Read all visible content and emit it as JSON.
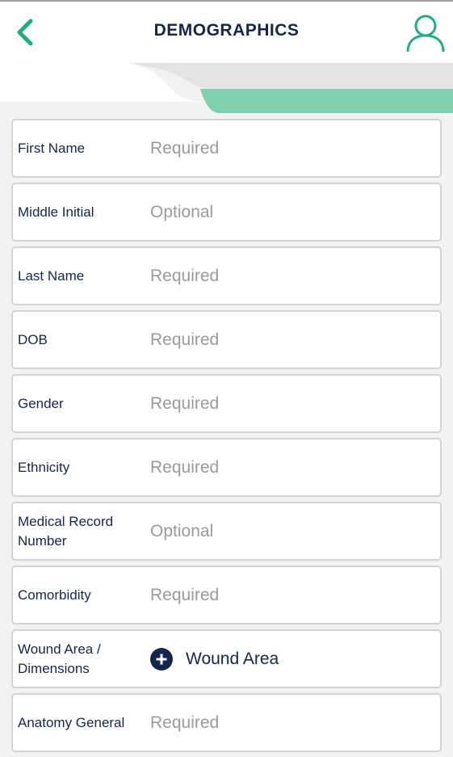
{
  "header": {
    "title": "DEMOGRAPHICS",
    "back_icon": "chevron-left-icon",
    "profile_icon": "user-icon",
    "accent_color": "#21ad7f"
  },
  "fields": [
    {
      "label": "First Name",
      "placeholder": "Required"
    },
    {
      "label": "Middle Initial",
      "placeholder": "Optional"
    },
    {
      "label": "Last Name",
      "placeholder": "Required"
    },
    {
      "label": "DOB",
      "placeholder": "Required"
    },
    {
      "label": "Gender",
      "placeholder": "Required"
    },
    {
      "label": "Ethnicity",
      "placeholder": "Required"
    },
    {
      "label": "Medical Record Number",
      "placeholder": "Optional"
    },
    {
      "label": "Comorbidity",
      "placeholder": "Required"
    }
  ],
  "wound_field": {
    "label": "Wound Area / Dimensions",
    "button_label": "Wound Area",
    "icon": "plus-circle-icon"
  },
  "last_field": {
    "label": "Anatomy General",
    "placeholder": "Required"
  }
}
